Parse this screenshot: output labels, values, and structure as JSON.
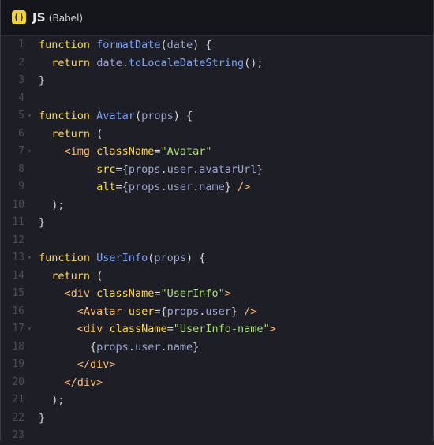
{
  "tab": {
    "language": "JS",
    "variant": "(Babel)"
  },
  "colors": {
    "background": "#1e1f26",
    "header": "#15161b",
    "keyword": "#ffd84a",
    "function_name": "#7aa2f7",
    "parameter": "#9aa5ce",
    "string": "#a9dc76",
    "tag": "#ffb86c",
    "line_number": "#4a4c57"
  },
  "lines": [
    {
      "n": "1",
      "fold": false,
      "tokens": [
        [
          "kw",
          "function"
        ],
        [
          "pn",
          " "
        ],
        [
          "fn",
          "formatDate"
        ],
        [
          "pn",
          "("
        ],
        [
          "par",
          "date"
        ],
        [
          "pn",
          ") {"
        ]
      ]
    },
    {
      "n": "2",
      "fold": false,
      "tokens": [
        [
          "pn",
          "  "
        ],
        [
          "kw",
          "return"
        ],
        [
          "pn",
          " "
        ],
        [
          "par",
          "date"
        ],
        [
          "pn",
          "."
        ],
        [
          "fn",
          "toLocaleDateString"
        ],
        [
          "pn",
          "();"
        ]
      ]
    },
    {
      "n": "3",
      "fold": false,
      "tokens": [
        [
          "pn",
          "}"
        ]
      ]
    },
    {
      "n": "4",
      "fold": false,
      "tokens": []
    },
    {
      "n": "5",
      "fold": true,
      "tokens": [
        [
          "kw",
          "function"
        ],
        [
          "pn",
          " "
        ],
        [
          "fn",
          "Avatar"
        ],
        [
          "pn",
          "("
        ],
        [
          "par",
          "props"
        ],
        [
          "pn",
          ") {"
        ]
      ]
    },
    {
      "n": "6",
      "fold": false,
      "tokens": [
        [
          "pn",
          "  "
        ],
        [
          "kw",
          "return"
        ],
        [
          "pn",
          " ("
        ]
      ]
    },
    {
      "n": "7",
      "fold": true,
      "tokens": [
        [
          "pn",
          "    "
        ],
        [
          "tag",
          "<img"
        ],
        [
          "pn",
          " "
        ],
        [
          "att",
          "className"
        ],
        [
          "pn",
          "="
        ],
        [
          "str",
          "\"Avatar\""
        ]
      ]
    },
    {
      "n": "8",
      "fold": false,
      "tokens": [
        [
          "pn",
          "         "
        ],
        [
          "att",
          "src"
        ],
        [
          "pn",
          "={"
        ],
        [
          "par",
          "props"
        ],
        [
          "pn",
          "."
        ],
        [
          "prop",
          "user"
        ],
        [
          "pn",
          "."
        ],
        [
          "prop",
          "avatarUrl"
        ],
        [
          "pn",
          "}"
        ]
      ]
    },
    {
      "n": "9",
      "fold": false,
      "tokens": [
        [
          "pn",
          "         "
        ],
        [
          "att",
          "alt"
        ],
        [
          "pn",
          "={"
        ],
        [
          "par",
          "props"
        ],
        [
          "pn",
          "."
        ],
        [
          "prop",
          "user"
        ],
        [
          "pn",
          "."
        ],
        [
          "prop",
          "name"
        ],
        [
          "pn",
          "} "
        ],
        [
          "tag",
          "/>"
        ]
      ]
    },
    {
      "n": "10",
      "fold": false,
      "tokens": [
        [
          "pn",
          "  );"
        ]
      ]
    },
    {
      "n": "11",
      "fold": false,
      "tokens": [
        [
          "pn",
          "}"
        ]
      ]
    },
    {
      "n": "12",
      "fold": false,
      "tokens": []
    },
    {
      "n": "13",
      "fold": true,
      "tokens": [
        [
          "kw",
          "function"
        ],
        [
          "pn",
          " "
        ],
        [
          "fn",
          "UserInfo"
        ],
        [
          "pn",
          "("
        ],
        [
          "par",
          "props"
        ],
        [
          "pn",
          ") {"
        ]
      ]
    },
    {
      "n": "14",
      "fold": false,
      "tokens": [
        [
          "pn",
          "  "
        ],
        [
          "kw",
          "return"
        ],
        [
          "pn",
          " ("
        ]
      ]
    },
    {
      "n": "15",
      "fold": false,
      "tokens": [
        [
          "pn",
          "    "
        ],
        [
          "tag",
          "<div"
        ],
        [
          "pn",
          " "
        ],
        [
          "att",
          "className"
        ],
        [
          "pn",
          "="
        ],
        [
          "str",
          "\"UserInfo\""
        ],
        [
          "tag",
          ">"
        ]
      ]
    },
    {
      "n": "16",
      "fold": false,
      "tokens": [
        [
          "pn",
          "      "
        ],
        [
          "tag",
          "<Avatar"
        ],
        [
          "pn",
          " "
        ],
        [
          "att",
          "user"
        ],
        [
          "pn",
          "={"
        ],
        [
          "par",
          "props"
        ],
        [
          "pn",
          "."
        ],
        [
          "prop",
          "user"
        ],
        [
          "pn",
          "} "
        ],
        [
          "tag",
          "/>"
        ]
      ]
    },
    {
      "n": "17",
      "fold": true,
      "tokens": [
        [
          "pn",
          "      "
        ],
        [
          "tag",
          "<div"
        ],
        [
          "pn",
          " "
        ],
        [
          "att",
          "className"
        ],
        [
          "pn",
          "="
        ],
        [
          "str",
          "\"UserInfo-name\""
        ],
        [
          "tag",
          ">"
        ]
      ]
    },
    {
      "n": "18",
      "fold": false,
      "tokens": [
        [
          "pn",
          "        {"
        ],
        [
          "par",
          "props"
        ],
        [
          "pn",
          "."
        ],
        [
          "prop",
          "user"
        ],
        [
          "pn",
          "."
        ],
        [
          "prop",
          "name"
        ],
        [
          "pn",
          "}"
        ]
      ]
    },
    {
      "n": "19",
      "fold": false,
      "tokens": [
        [
          "pn",
          "      "
        ],
        [
          "tag",
          "</div>"
        ]
      ]
    },
    {
      "n": "20",
      "fold": false,
      "tokens": [
        [
          "pn",
          "    "
        ],
        [
          "tag",
          "</div>"
        ]
      ]
    },
    {
      "n": "21",
      "fold": false,
      "tokens": [
        [
          "pn",
          "  );"
        ]
      ]
    },
    {
      "n": "22",
      "fold": false,
      "tokens": [
        [
          "pn",
          "}"
        ]
      ]
    },
    {
      "n": "23",
      "fold": false,
      "tokens": []
    }
  ]
}
